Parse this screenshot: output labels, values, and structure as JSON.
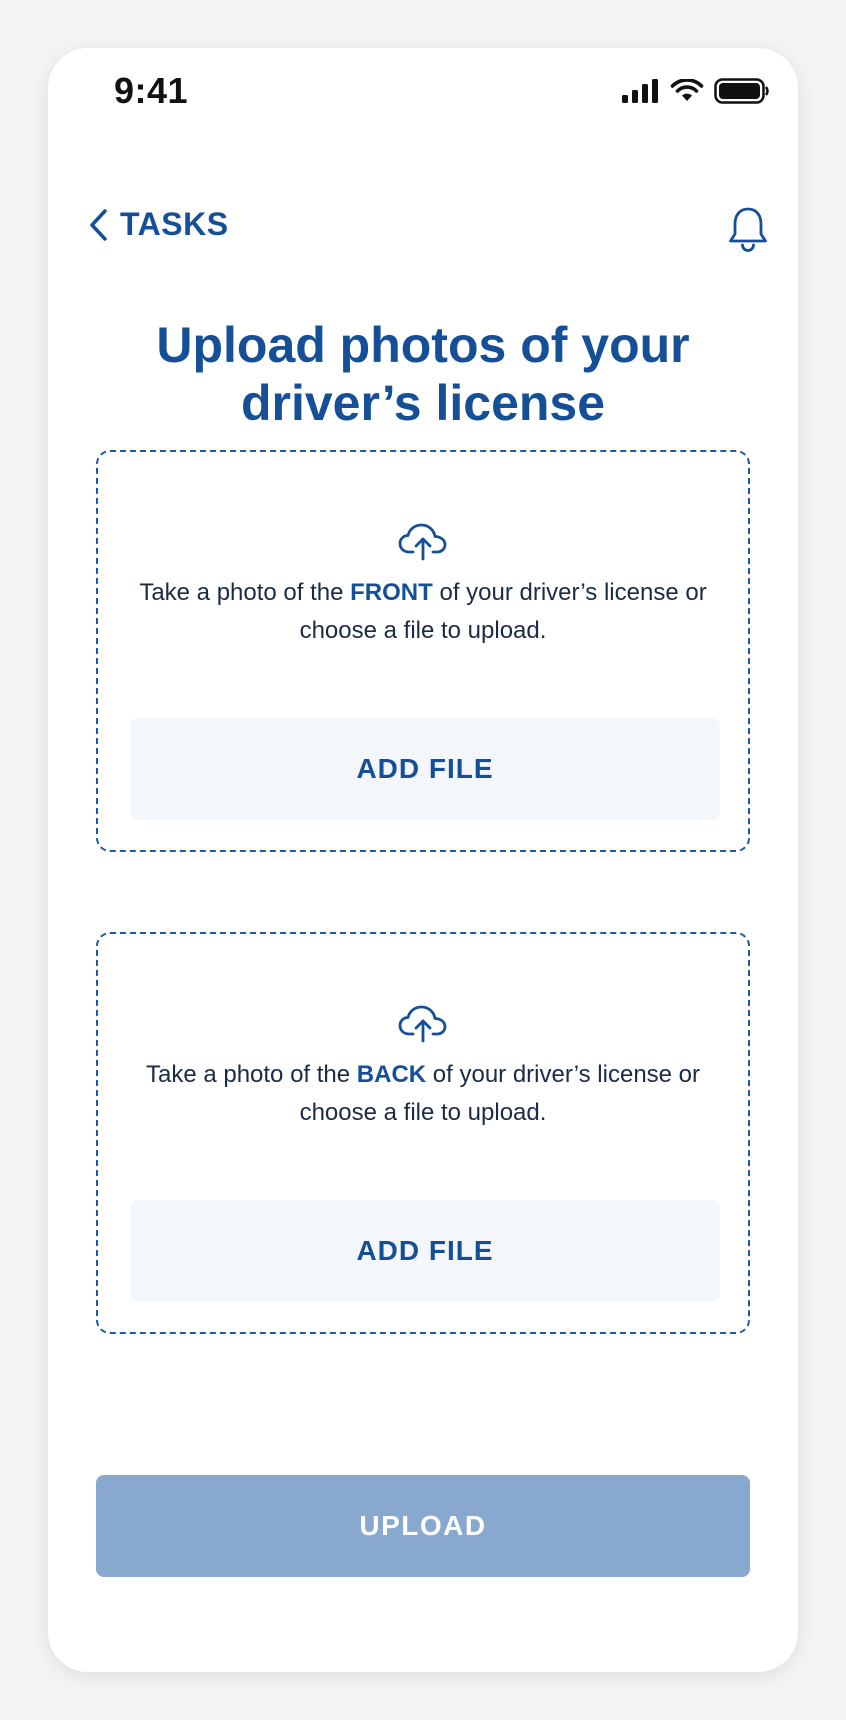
{
  "status_bar": {
    "time": "9:41"
  },
  "nav": {
    "back_label": "TASKS",
    "back_icon": "chevron-left-icon",
    "notification_icon": "bell-icon"
  },
  "page": {
    "title": "Upload photos of your driver’s license"
  },
  "cards": [
    {
      "icon": "cloud-upload-icon",
      "text_before": "Take a photo of the ",
      "text_emphasis": "FRONT",
      "text_after": " of your driver’s license or choose a file to upload.",
      "button_label": "ADD FILE"
    },
    {
      "icon": "cloud-upload-icon",
      "text_before": "Take a photo of the ",
      "text_emphasis": "BACK",
      "text_after": " of your driver’s license or choose a file to upload.",
      "button_label": "ADD FILE"
    }
  ],
  "footer": {
    "upload_label": "UPLOAD"
  },
  "colors": {
    "primary": "#154f97",
    "upload_disabled": "#88a8cf",
    "add_file_bg": "#f3f6fb",
    "body_text": "#1c2b45"
  }
}
